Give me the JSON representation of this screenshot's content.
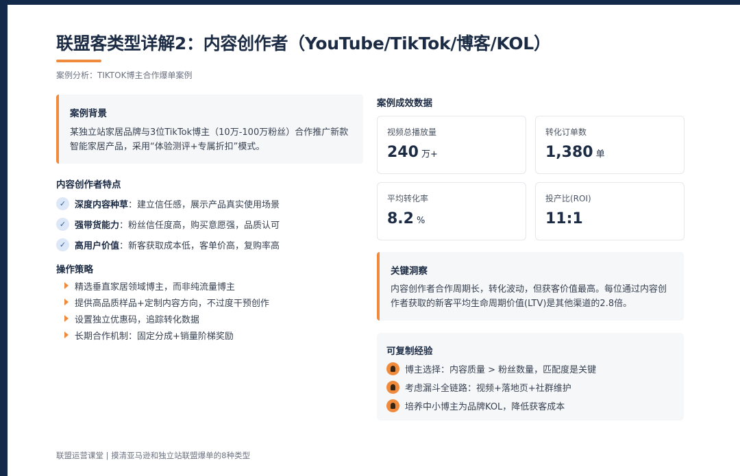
{
  "header": {
    "title": "联盟客类型详解2：内容创作者（YouTube/TikTok/博客/KOL）",
    "subtitle": "案例分析：TIKTOK博主合作爆单案例"
  },
  "background": {
    "heading": "案例背景",
    "text": "某独立站家居品牌与3位TikTok博主（10万-100万粉丝）合作推广新款智能家居产品，采用“体验测评+专属折扣”模式。"
  },
  "features": {
    "heading": "内容创作者特点",
    "items": [
      {
        "title": "深度内容种草",
        "desc": "：建立信任感，展示产品真实使用场景"
      },
      {
        "title": "强带货能力",
        "desc": "：粉丝信任度高，购买意愿强，品质认可"
      },
      {
        "title": "高用户价值",
        "desc": "：新客获取成本低，客单价高，复购率高"
      }
    ]
  },
  "strategy": {
    "heading": "操作策略",
    "items": [
      "精选垂直家居领域博主，而非纯流量博主",
      "提供高品质样品+定制内容方向，不过度干预创作",
      "设置独立优惠码，追踪转化数据",
      "长期合作机制：固定分成+销量阶梯奖励"
    ]
  },
  "results": {
    "heading": "案例成效数据",
    "stats": [
      {
        "label": "视频总播放量",
        "value": "240",
        "unit": "万+"
      },
      {
        "label": "转化订单数",
        "value": "1,380",
        "unit": "单"
      },
      {
        "label": "平均转化率",
        "value": "8.2",
        "unit": "%"
      },
      {
        "label": "投产比(ROI)",
        "value": "11:1",
        "unit": ""
      }
    ]
  },
  "insight": {
    "heading": "关键洞察",
    "text": "内容创作者合作周期长，转化波动，但获客价值最高。每位通过内容创作者获取的新客平均生命周期价值(LTV)是其他渠道的2.8倍。"
  },
  "experience": {
    "heading": "可复制经验",
    "items": [
      "博主选择：内容质量 > 粉丝数量，匹配度是关键",
      "考虑漏斗全链路：视频+落地页+社群维护",
      "培养中小博主为品牌KOL，降低获客成本"
    ]
  },
  "footer": "联盟运营课堂 | 摸清亚马逊和独立站联盟爆单的8种类型",
  "colors": {
    "accent": "#f08a3c",
    "navy": "#142a4a"
  }
}
